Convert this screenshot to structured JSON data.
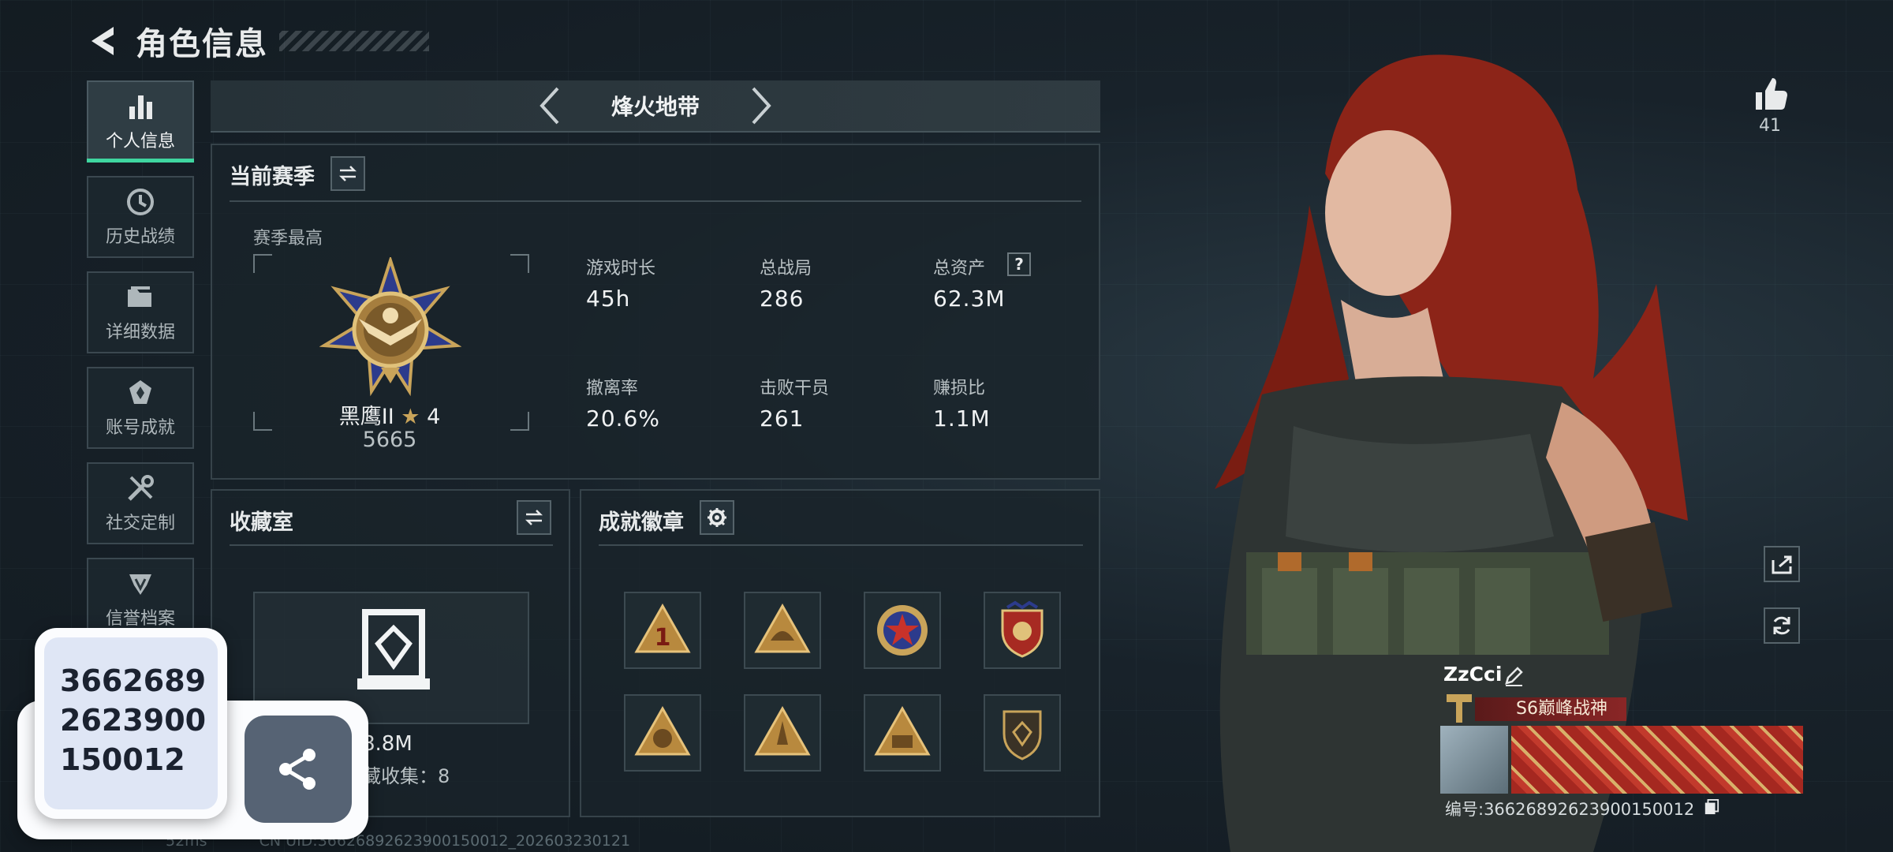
{
  "header": {
    "title": "角色信息"
  },
  "sidebar": {
    "items": [
      {
        "label": "个人信息",
        "icon": "bar-chart-icon",
        "active": true
      },
      {
        "label": "历史战绩",
        "icon": "history-clock-icon"
      },
      {
        "label": "详细数据",
        "icon": "folder-icon"
      },
      {
        "label": "账号成就",
        "icon": "achievement-icon"
      },
      {
        "label": "社交定制",
        "icon": "tools-icon"
      },
      {
        "label": "信誉档案",
        "icon": "credit-icon"
      }
    ]
  },
  "mode": {
    "title": "烽火地带"
  },
  "season": {
    "title": "当前赛季",
    "best_label": "赛季最高",
    "rank_name": "黑鹰II",
    "rank_stars": "4",
    "rank_score": "5665",
    "stats": [
      {
        "label": "游戏时长",
        "value": "45h"
      },
      {
        "label": "总战局",
        "value": "286"
      },
      {
        "label": "总资产",
        "value": "62.3M",
        "help": "?"
      },
      {
        "label": "撤离率",
        "value": "20.6%"
      },
      {
        "label": "击败干员",
        "value": "261"
      },
      {
        "label": "赚损比",
        "value": "1.1M"
      }
    ]
  },
  "collection": {
    "title": "收藏室",
    "value_partial": "8.8M",
    "collected_partial": "藏收集：8"
  },
  "achievements": {
    "title": "成就徽章",
    "badges": [
      "rank-1-badge",
      "helmet-badge",
      "star-emblem-badge",
      "shield-crest-badge",
      "s4-badge",
      "rocket-badge",
      "s6-badge",
      "dark-shield-badge"
    ]
  },
  "likes": {
    "count": "41"
  },
  "player": {
    "name": "ZzCci",
    "title": "S6巅峰战神",
    "id_text": "编号:3662689262390015001​2"
  },
  "footer": {
    "ping": "52ms",
    "uid_text": "CN UID:3662689262390015001​2_202603230121"
  },
  "popup": {
    "number_lines": [
      "3662689",
      "2623900",
      "150012"
    ]
  },
  "colors": {
    "accent": "#3fd6a0",
    "panel_border": "#36434a",
    "popup_bg": "#dfe6f5",
    "share_btn": "#566374"
  }
}
